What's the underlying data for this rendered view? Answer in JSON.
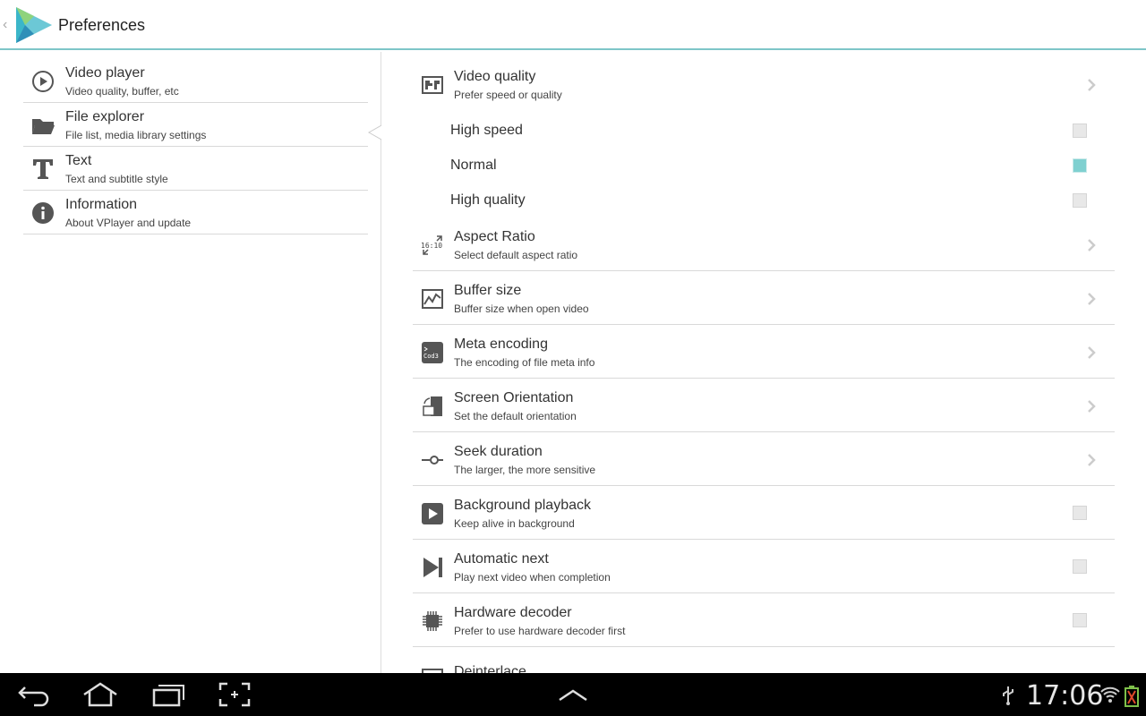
{
  "app": {
    "title": "Preferences",
    "back_glyph": "‹"
  },
  "categories": [
    {
      "title": "Video player",
      "subtitle": "Video quality, buffer, etc",
      "icon": "play-circle-icon"
    },
    {
      "title": "File explorer",
      "subtitle": "File list, media library settings",
      "icon": "folder-icon"
    },
    {
      "title": "Text",
      "subtitle": "Text and subtitle style",
      "icon": "text-icon"
    },
    {
      "title": "Information",
      "subtitle": "About VPlayer and update",
      "icon": "info-icon"
    }
  ],
  "video_quality": {
    "title": "Video quality",
    "subtitle": "Prefer speed or quality",
    "options": [
      {
        "label": "High speed",
        "checked": false
      },
      {
        "label": "Normal",
        "checked": true
      },
      {
        "label": "High quality",
        "checked": false
      }
    ]
  },
  "settings": [
    {
      "title": "Aspect Ratio",
      "subtitle": "Select default aspect ratio",
      "icon": "aspect-ratio-icon",
      "icon_text": "16:10",
      "control": "chevron"
    },
    {
      "title": "Buffer size",
      "subtitle": "Buffer size when open video",
      "icon": "chart-icon",
      "control": "chevron"
    },
    {
      "title": "Meta encoding",
      "subtitle": "The encoding of file meta info",
      "icon": "code-icon",
      "icon_text": "Cod3",
      "control": "chevron"
    },
    {
      "title": "Screen Orientation",
      "subtitle": "Set the default orientation",
      "icon": "orientation-icon",
      "control": "chevron"
    },
    {
      "title": "Seek duration",
      "subtitle": "The larger, the more sensitive",
      "icon": "seek-icon",
      "control": "chevron"
    },
    {
      "title": "Background playback",
      "subtitle": "Keep alive in background",
      "icon": "play-box-icon",
      "control": "checkbox",
      "checked": false
    },
    {
      "title": "Automatic next",
      "subtitle": "Play next video when completion",
      "icon": "skip-next-icon",
      "control": "checkbox",
      "checked": false
    },
    {
      "title": "Hardware decoder",
      "subtitle": "Prefer to use hardware decoder first",
      "icon": "chip-icon",
      "control": "checkbox",
      "checked": false
    }
  ],
  "cut_off_item": {
    "title": "Deinterlace"
  },
  "system_bar": {
    "clock": "17:06"
  },
  "colors": {
    "accent": "#7ec6c8",
    "checked": "#7fd0d0",
    "system_bar": "#000000"
  }
}
